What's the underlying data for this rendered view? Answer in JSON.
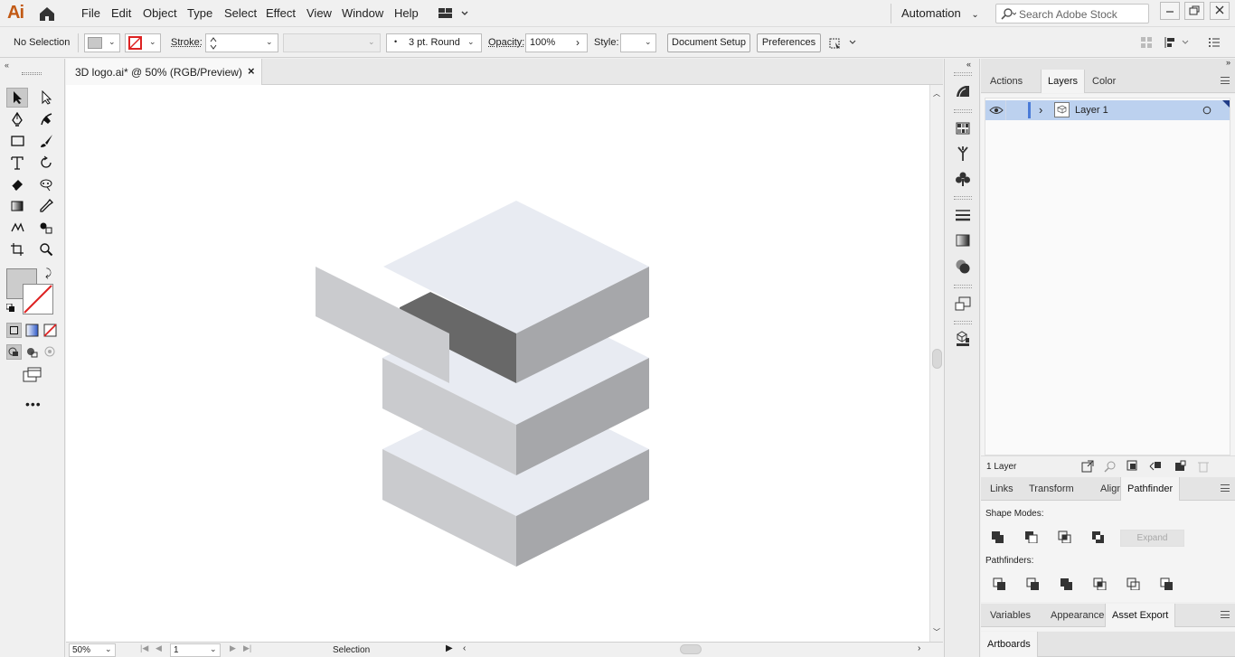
{
  "app": {
    "logo": "Ai"
  },
  "menu": [
    "File",
    "Edit",
    "Object",
    "Type",
    "Select",
    "Effect",
    "View",
    "Window",
    "Help"
  ],
  "workspace": {
    "label": "Automation"
  },
  "search": {
    "placeholder": "Search Adobe Stock"
  },
  "control": {
    "selection_label": "No Selection",
    "stroke_label": "Stroke:",
    "stroke_profile": "3 pt. Round",
    "opacity_label": "Opacity:",
    "opacity_value": "100%",
    "style_label": "Style:",
    "document_setup": "Document Setup",
    "preferences": "Preferences"
  },
  "document": {
    "tab_title": "3D logo.ai* @ 50% (RGB/Preview)",
    "zoom": "50%",
    "artboard": "1",
    "status_tool": "Selection"
  },
  "layers_panel": {
    "tabs": [
      "Actions",
      "Layers",
      "Color"
    ],
    "active_tab": "Layers",
    "layers": [
      {
        "name": "Layer 1"
      }
    ],
    "footer_count": "1 Layer"
  },
  "pathfinder_panel": {
    "tabs": [
      "Links",
      "Transform",
      "Align",
      "Pathfinder"
    ],
    "active_tab": "Pathfinder",
    "shape_modes_label": "Shape Modes:",
    "expand_label": "Expand",
    "pathfinders_label": "Pathfinders:"
  },
  "export_panel": {
    "tabs": [
      "Variables",
      "Appearance",
      "Asset Export"
    ],
    "active_tab": "Asset Export"
  },
  "artboards_panel": {
    "tabs": [
      "Artboards"
    ]
  },
  "colors": {
    "accent": "#4a7bd8",
    "layer_row_bg": "#bcd1ef",
    "top_face": "#e8ebf2",
    "left_face": "#cacbce",
    "right_face": "#a6a7aa",
    "dark_face": "#6a6a6a"
  }
}
